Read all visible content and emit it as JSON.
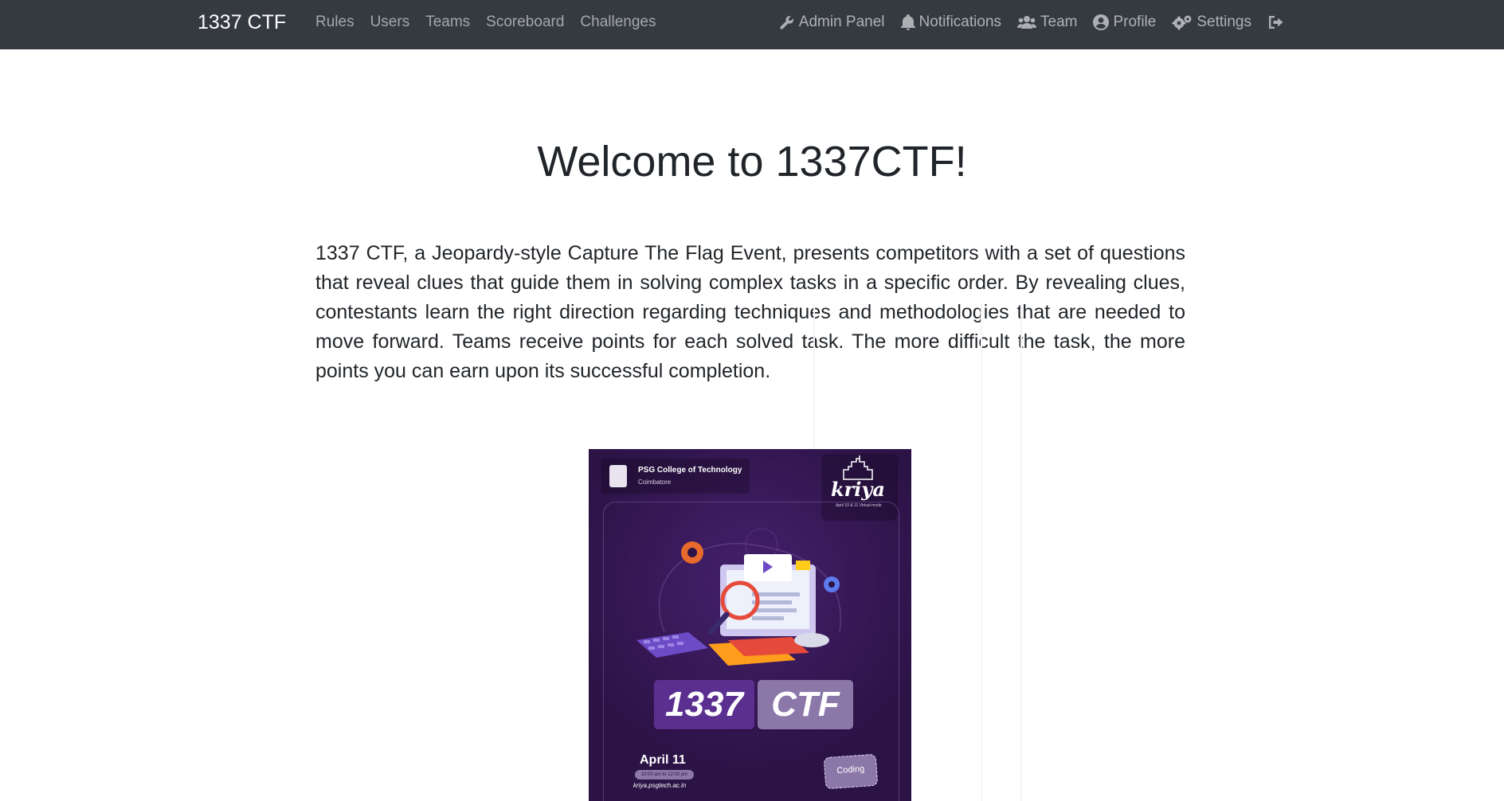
{
  "navbar": {
    "brand": "1337 CTF",
    "left_links": [
      {
        "label": "Rules"
      },
      {
        "label": "Users"
      },
      {
        "label": "Teams"
      },
      {
        "label": "Scoreboard"
      },
      {
        "label": "Challenges"
      }
    ],
    "right_links": [
      {
        "label": "Admin Panel",
        "icon": "wrench-icon"
      },
      {
        "label": "Notifications",
        "icon": "bell-icon"
      },
      {
        "label": "Team",
        "icon": "users-icon"
      },
      {
        "label": "Profile",
        "icon": "user-circle-icon"
      },
      {
        "label": "Settings",
        "icon": "cogs-icon"
      },
      {
        "label": "",
        "icon": "sign-out-icon"
      }
    ],
    "colors": {
      "background": "#343a40",
      "brand": "#ffffff"
    }
  },
  "main": {
    "title": "Welcome to 1337CTF!",
    "intro": "1337 CTF, a Jeopardy-style Capture The Flag Event, presents competitors with a set of questions that reveal clues that guide them in solving complex tasks in a specific order. By revealing clues, contestants learn the right direction regarding techniques and methodologies that are needed to move forward. Teams receive points for each solved task. The more difficult the task, the more points you can earn upon its successful completion."
  },
  "poster": {
    "college_name": "PSG College of Technology",
    "college_city": "Coimbatore",
    "fest_logo": "kriya",
    "fest_sub": "April 10 & 11 Virtual mode",
    "ctf_left": "1337",
    "ctf_right": "CTF",
    "date": "April 11",
    "time": "10:00 am to 12:00 pm",
    "site": "kriya.psgtech.ac.in",
    "badge": "Coding",
    "colors": {
      "background": "#2c1346",
      "accent": "#5a2f8f",
      "muted": "#8c77a9"
    }
  }
}
